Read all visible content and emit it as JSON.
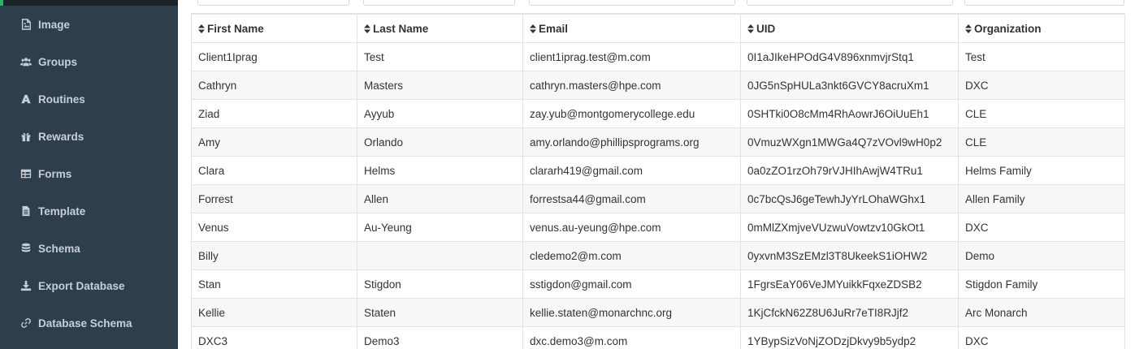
{
  "sidebar": {
    "items": [
      {
        "label": "Image",
        "icon": "image-icon"
      },
      {
        "label": "Groups",
        "icon": "groups-icon"
      },
      {
        "label": "Routines",
        "icon": "routines-icon"
      },
      {
        "label": "Rewards",
        "icon": "gift-icon"
      },
      {
        "label": "Forms",
        "icon": "table-icon"
      },
      {
        "label": "Template",
        "icon": "file-icon"
      },
      {
        "label": "Schema",
        "icon": "database-icon"
      },
      {
        "label": "Export Database",
        "icon": "download-icon"
      },
      {
        "label": "Database Schema",
        "icon": "link-icon"
      }
    ]
  },
  "table": {
    "columns": [
      "First Name",
      "Last Name",
      "Email",
      "UID",
      "Organization"
    ],
    "rows": [
      [
        "Client1Iprag",
        "Test",
        "client1iprag.test@m.com",
        "0I1aJIkeHPOdG4V896xnmvjrStq1",
        "Test"
      ],
      [
        "Cathryn",
        "Masters",
        "cathryn.masters@hpe.com",
        "0JG5nSpHULa3nkt6GVCY8acruXm1",
        "DXC"
      ],
      [
        "Ziad",
        "Ayyub",
        "zay.yub@montgomerycollege.edu",
        "0SHTki0O8cMm4RhAowrJ6OiUuEh1",
        "CLE"
      ],
      [
        "Amy",
        "Orlando",
        "amy.orlando@phillipsprograms.org",
        "0VmuzWXgn1MWGa4Q7zVOvl9wH0p2",
        "CLE"
      ],
      [
        "Clara",
        "Helms",
        "clararh419@gmail.com",
        "0a0zZO1rzOh79rVJHIhAwjW4TRu1",
        "Helms Family"
      ],
      [
        "Forrest",
        "Allen",
        "forrestsa44@gmail.com",
        "0c7bcQsJ6geTewhJyYrLOhaWGhx1",
        "Allen Family"
      ],
      [
        "Venus",
        "Au-Yeung",
        "venus.au-yeung@hpe.com",
        "0mMlZXmjveVUzwuVowtzv10GkOt1",
        "DXC"
      ],
      [
        "Billy",
        "",
        "cledemo2@m.com",
        "0yxvnM3SzEMzl3T8UkeekS1iOHW2",
        "Demo"
      ],
      [
        "Stan",
        "Stigdon",
        "sstigdon@gmail.com",
        "1FgrsEaY06VeJMYuikkFqxeZDSB2",
        "Stigdon Family"
      ],
      [
        "Kellie",
        "Staten",
        "kellie.staten@monarchnc.org",
        "1KjCfckN62Z8U6JuRr7eTI8RJjf2",
        "Arc Monarch"
      ],
      [
        "DXC3",
        "Demo3",
        "dxc.demo3@m.com",
        "1YBypSizVoNjZODzjDkvy9b5ydp2",
        "DXC"
      ]
    ]
  },
  "colors": {
    "sidebar_bg": "#2f3e4d",
    "sidebar_text": "#c7d0d8",
    "accent": "#29b76f",
    "row_stripe": "#f7f7f7",
    "border": "#e3e3e3"
  }
}
